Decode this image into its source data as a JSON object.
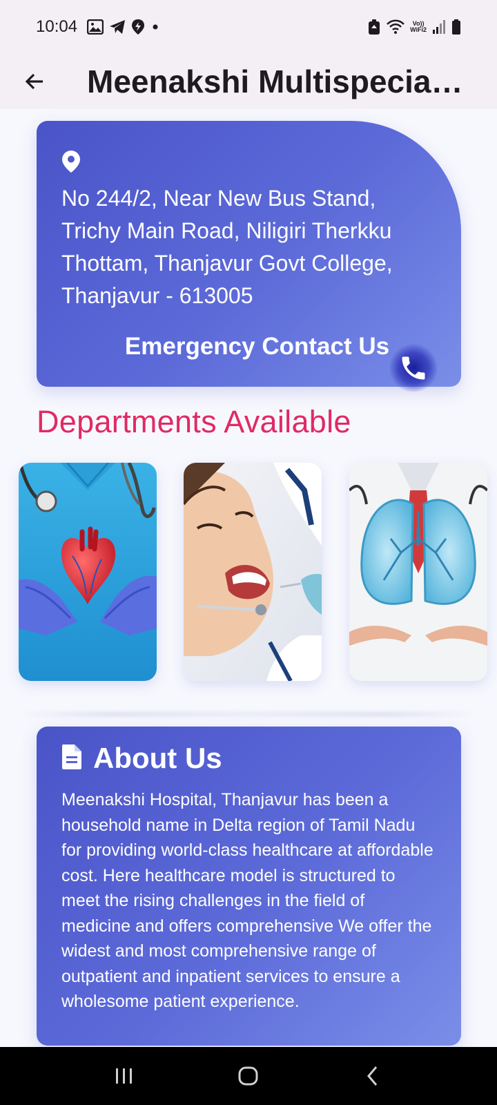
{
  "status_bar": {
    "time": "10:04",
    "wifi_label_top": "Vo))",
    "wifi_label_bottom": "WiFi2"
  },
  "app_bar": {
    "title": "Meenakshi Multispeciality Hospital"
  },
  "address_card": {
    "address": "No 244/2, Near New Bus Stand, Trichy Main Road, Niligiri Therkku Thottam, Thanjavur Govt College, Thanjavur - 613005",
    "emergency_label": "Emergency Contact Us",
    "icon": "location-pin-icon"
  },
  "departments": {
    "heading": "Departments Available",
    "items": [
      {
        "icon": "heart-cardiology-image"
      },
      {
        "icon": "dental-image"
      },
      {
        "icon": "lungs-pulmonology-image"
      }
    ]
  },
  "about": {
    "title": "About Us",
    "text": "Meenakshi Hospital, Thanjavur has been a household name in Delta region of Tamil Nadu for providing world-class healthcare at affordable cost. Here healthcare model is structured to meet the rising challenges in the field of medicine and offers comprehensive We offer the widest and most comprehensive range of outpatient and inpatient services to ensure a wholesome patient experience.",
    "icon": "document-icon"
  },
  "colors": {
    "accent_heading": "#e02a63",
    "card_gradient_start": "#4a54c8",
    "card_gradient_end": "#7a8ee8",
    "app_bar_bg": "#f4eff4"
  }
}
